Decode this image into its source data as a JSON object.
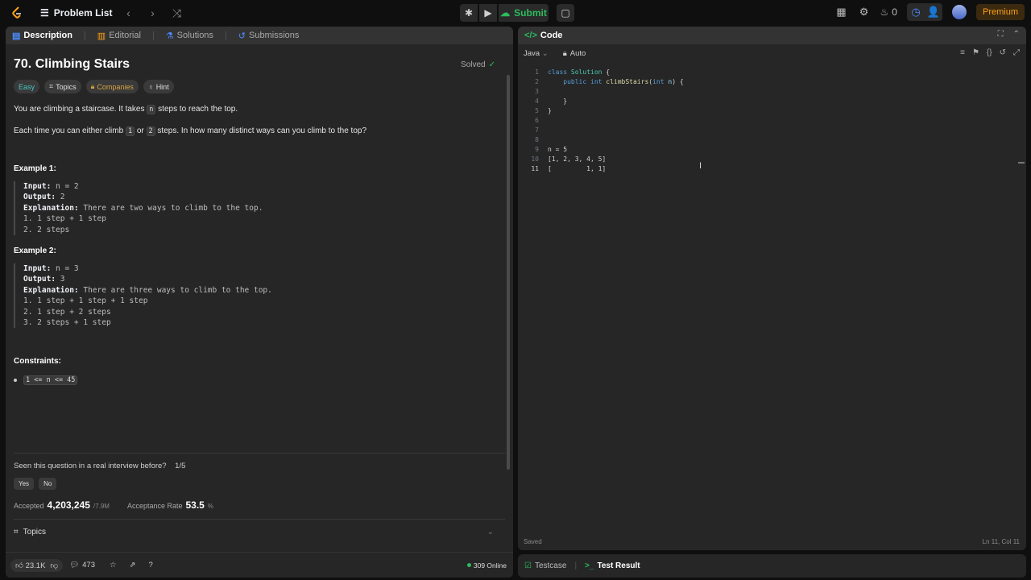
{
  "topbar": {
    "problem_list": "Problem List",
    "submit": "Submit",
    "streak": "0",
    "premium": "Premium"
  },
  "left": {
    "tabs": [
      "Description",
      "Editorial",
      "Solutions",
      "Submissions"
    ],
    "title": "70. Climbing Stairs",
    "solved": "Solved",
    "tags": [
      "Easy",
      "Topics",
      "Companies",
      "Hint"
    ],
    "p1_a": "You are climbing a staircase. It takes ",
    "p1_code": "n",
    "p1_b": " steps to reach the top.",
    "p2_a": "Each time you can either climb ",
    "p2_c1": "1",
    "p2_or": " or ",
    "p2_c2": "2",
    "p2_b": " steps. In how many distinct ways can you climb to the top?",
    "ex1": {
      "heading": "Example 1:",
      "input_label": "Input:",
      "input": " n = 2",
      "output_label": "Output:",
      "output": " 2",
      "expl_label": "Explanation:",
      "expl": " There are two ways to climb to the top.",
      "lines": [
        "1. 1 step + 1 step",
        "2. 2 steps"
      ]
    },
    "ex2": {
      "heading": "Example 2:",
      "input_label": "Input:",
      "input": " n = 3",
      "output_label": "Output:",
      "output": " 3",
      "expl_label": "Explanation:",
      "expl": " There are three ways to climb to the top.",
      "lines": [
        "1. 1 step + 1 step + 1 step",
        "2. 1 step + 2 steps",
        "3. 2 steps + 1 step"
      ]
    },
    "constraints_heading": "Constraints:",
    "constraint": "1 <= n <= 45",
    "interview_q": "Seen this question in a real interview before?",
    "interview_count": "1/5",
    "yes": "Yes",
    "no": "No",
    "accepted_label": "Accepted",
    "accepted_value": "4,203,245",
    "accepted_total": "/7.9M",
    "rate_label": "Acceptance Rate",
    "rate_value": "53.5",
    "rate_unit": "%",
    "topics": "Topics",
    "likes": "23.1K",
    "comments": "473",
    "online": "309 Online"
  },
  "code": {
    "title": "Code",
    "language": "Java",
    "auto": "Auto",
    "lines": [
      "class Solution {",
      "    public int climbStairs(int n) {",
      "",
      "    }",
      "}",
      "",
      "",
      "",
      "n = 5",
      "[1, 2, 3, 4, 5]",
      "[         1, 1]"
    ],
    "status": "Saved",
    "position": "Ln 11, Col 11"
  },
  "bottom": {
    "tabs": [
      "Testcase",
      "Test Result"
    ]
  },
  "colors": {
    "accent_green": "#2cbb5d",
    "premium_orange": "#ffa116",
    "easy_teal": "#46c6c2"
  }
}
